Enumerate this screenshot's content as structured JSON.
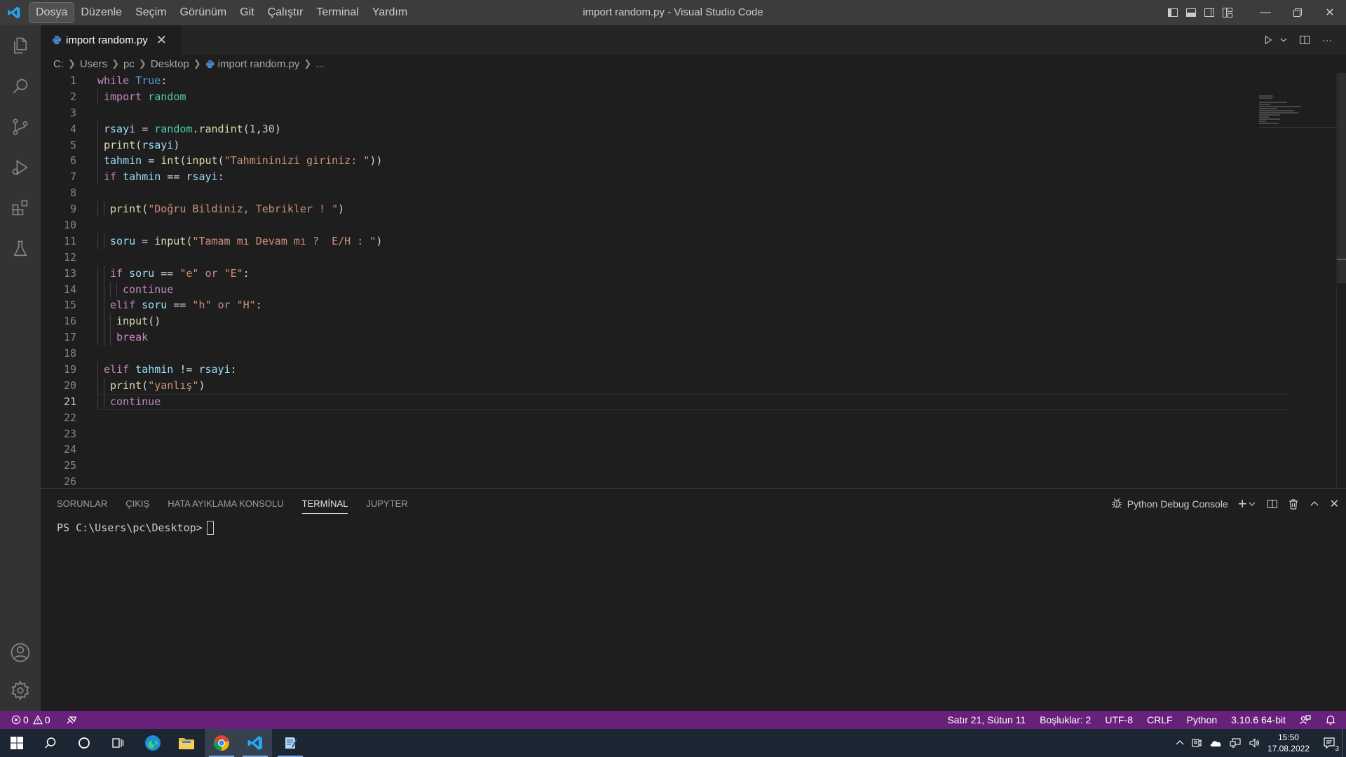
{
  "titlebar": {
    "window_title": "import random.py - Visual Studio Code",
    "menu": [
      "Dosya",
      "Düzenle",
      "Seçim",
      "Görünüm",
      "Git",
      "Çalıştır",
      "Terminal",
      "Yardım"
    ],
    "active_menu": "Dosya"
  },
  "activity_bar": {
    "items": [
      "explorer-icon",
      "search-icon",
      "source-control-icon",
      "run-debug-icon",
      "extensions-icon",
      "testing-icon"
    ],
    "bottom_items": [
      "accounts-icon",
      "settings-gear-icon"
    ]
  },
  "editor": {
    "tab": {
      "label": "import random.py",
      "close": "✕"
    },
    "breadcrumb": [
      "C:",
      "Users",
      "pc",
      "Desktop",
      "import random.py",
      "..."
    ],
    "current_line": 21,
    "line_numbers": [
      "1",
      "2",
      "3",
      "4",
      "5",
      "6",
      "7",
      "8",
      "9",
      "10",
      "11",
      "12",
      "13",
      "14",
      "15",
      "16",
      "17",
      "18",
      "19",
      "20",
      "21",
      "22",
      "23",
      "24",
      "25",
      "26"
    ],
    "code_lines": [
      "while True:",
      " import random",
      "",
      " rsayi = random.randint(1,30)",
      " print(rsayi)",
      " tahmin = int(input(\"Tahmininizi giriniz: \"))",
      " if tahmin == rsayi:",
      "",
      "  print(\"Doğru Bildiniz, Tebrikler ! \")",
      "",
      "  soru = input(\"Tamam mı Devam mı ?  E/H : \")",
      "",
      "  if soru == \"e\" or \"E\":",
      "    continue",
      "  elif soru == \"h\" or \"H\":",
      "   input()",
      "   break",
      "",
      " elif tahmin != rsayi:",
      "  print(\"yanlış\")",
      "  continue",
      "",
      "",
      "",
      "",
      ""
    ]
  },
  "panel": {
    "tabs": [
      "SORUNLAR",
      "ÇIKIŞ",
      "HATA AYIKLAMA KONSOLU",
      "TERMİNAL",
      "JUPYTER"
    ],
    "active_tab": "TERMİNAL",
    "terminal_profile": "Python Debug Console",
    "terminal_prompt": "PS C:\\Users\\pc\\Desktop>"
  },
  "statusbar": {
    "errors": "0",
    "warnings": "0",
    "position": "Satır 21, Sütun 11",
    "spaces": "Boşluklar: 2",
    "encoding": "UTF-8",
    "eol": "CRLF",
    "language": "Python",
    "interpreter": "3.10.6 64-bit"
  },
  "taskbar": {
    "clock_time": "15:50",
    "clock_date": "17.08.2022",
    "notification_count": "3"
  },
  "colors": {
    "statusbar": "#68217a",
    "titlebar": "#3c3c3c",
    "activitybar": "#333333",
    "editor_bg": "#1e1e1e"
  }
}
